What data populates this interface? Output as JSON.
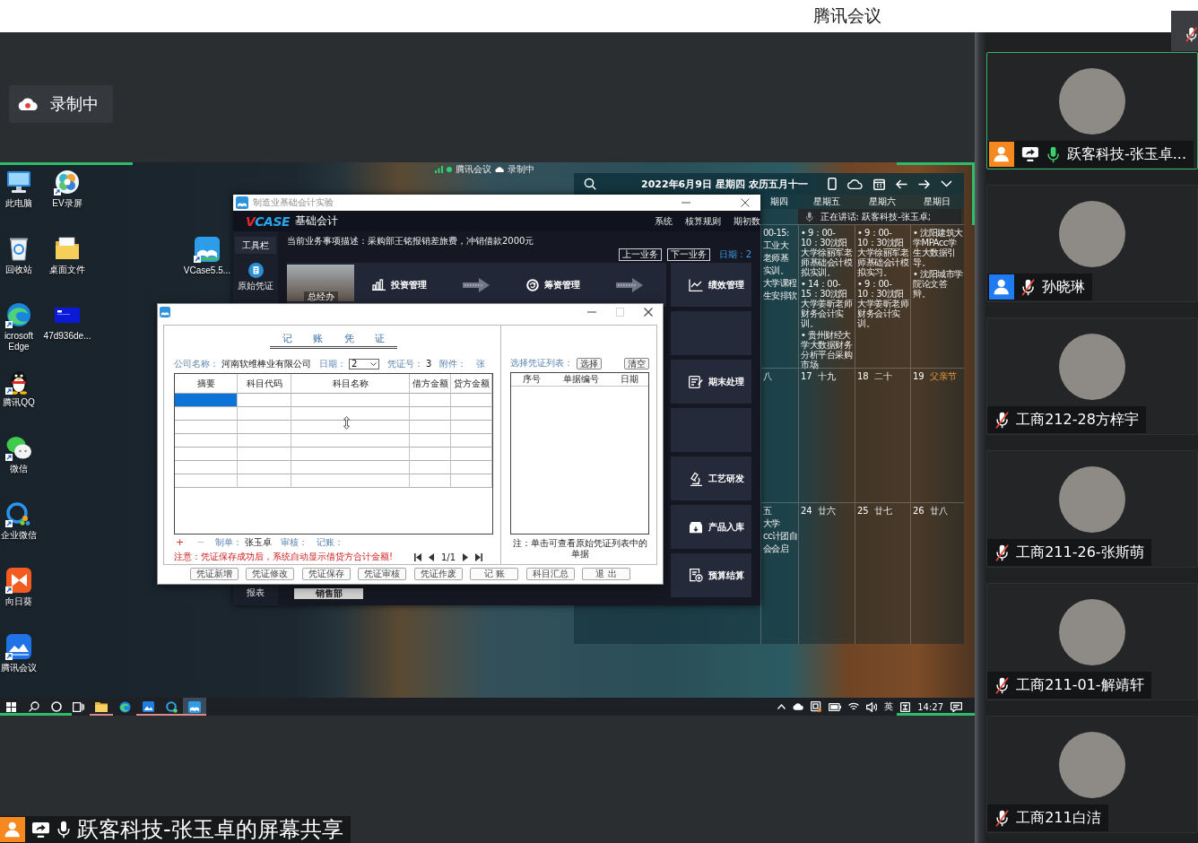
{
  "top_bar": {
    "title": "腾讯会议"
  },
  "recording": {
    "label": "录制中"
  },
  "shared_screen": {
    "icon_columns": [
      [
        {
          "label": "此电脑",
          "kind": "computer",
          "shortcut": false
        },
        {
          "label": "回收站",
          "kind": "recycle",
          "shortcut": false
        },
        {
          "label": "icrosoft Edge",
          "kind": "edge",
          "shortcut": true
        },
        {
          "label": "腾讯QQ",
          "kind": "qq",
          "shortcut": true
        },
        {
          "label": "微信",
          "kind": "wechat",
          "shortcut": true
        },
        {
          "label": "企业微信",
          "kind": "wecom",
          "shortcut": true
        },
        {
          "label": "向日葵",
          "kind": "sunlogin",
          "shortcut": true
        },
        {
          "label": "腾讯会议",
          "kind": "meeting",
          "shortcut": true
        }
      ],
      [
        {
          "label": "EV录屏",
          "kind": "ev",
          "shortcut": true
        },
        {
          "label": "桌面文件",
          "kind": "folder",
          "shortcut": false
        },
        {
          "label": "47d936de...",
          "kind": "image",
          "shortcut": false
        }
      ]
    ],
    "app_shortcut": {
      "label": "VCase5.5...",
      "kind": "vcase",
      "shortcut": true
    },
    "meeting_bar": {
      "app": "腾讯会议",
      "status": "录制中"
    },
    "calendar": {
      "date_line": "2022年6月9日 星期四 农历五月十一",
      "weekdays": [
        "期四",
        "星期五",
        "星期六",
        "星期日"
      ],
      "weeks": [
        {
          "days": [
            {
              "fragments": [
                "00-15:",
                "工业大",
                "老师基",
                "实训。",
                "大学课程",
                "生安排软"
              ]
            },
            {
              "events": [
                "• 9：00-10：30沈阳大学徐丽军老师基础会计模拟实训。",
                "• 14：00-15：30沈阳大学姜昕老师财务会计实训。",
                "• 贵州财经大学大数据财务分析平台采购市场"
              ]
            },
            {
              "events": [
                "• 9：00-10：30沈阳大学徐丽军老师基础会计模拟实习。",
                "• 9：00-10：30沈阳大学姜昕老师财务会计实训。"
              ]
            },
            {
              "events": [
                "• 沈阳建筑大学MPAcc学生大数据引导。",
                "• 沈阳城市学院论文答辩。"
              ]
            }
          ]
        },
        {
          "days": [
            {
              "fragments": [
                "八"
              ]
            },
            {
              "date": "17",
              "lunar": "十九",
              "festival": false
            },
            {
              "date": "18",
              "lunar": "二十",
              "festival": false
            },
            {
              "date": "19",
              "lunar": "父亲节",
              "festival": true
            }
          ]
        },
        {
          "days": [
            {
              "fragments": [
                "五",
                "大学",
                "cc计团自",
                "会会启"
              ]
            },
            {
              "date": "24",
              "lunar": "廿六",
              "festival": false
            },
            {
              "date": "25",
              "lunar": "廿七",
              "festival": false
            },
            {
              "date": "26",
              "lunar": "廿八",
              "festival": false
            }
          ]
        }
      ]
    },
    "speaking": {
      "label": "正在讲话: 跃客科技-张玉卓;"
    },
    "app_window": {
      "title": "制造业基础会计实验",
      "logo": [
        "V",
        "CASE"
      ],
      "product": "基础会计",
      "menu": [
        "系统",
        "核算规则",
        "期初数"
      ],
      "toolbar": {
        "label": "工具栏",
        "tools": [
          {
            "label": "原始凭证"
          }
        ],
        "bottom": "报表"
      },
      "task": "当前业务事项描述：采购部王铭报销差旅费，冲销借款2000元",
      "nav": [
        "上一业务",
        "下一业务"
      ],
      "date": "日期：2",
      "department": "总经办",
      "flow": [
        {
          "label": "投资管理",
          "kind": "bars"
        },
        {
          "label": "筹资管理",
          "kind": "cycle"
        }
      ],
      "modules": [
        {
          "kind": "trend",
          "label": "绩效管理"
        },
        {
          "kind": "blank"
        },
        {
          "kind": "doc",
          "label": "期末处理"
        },
        {
          "kind": "blank"
        },
        {
          "kind": "lab",
          "label": "工艺研发"
        },
        {
          "kind": "box",
          "label": "产品入库"
        },
        {
          "kind": "budget",
          "label": "预算结算"
        }
      ],
      "tab": "销售部"
    },
    "voucher": {
      "title": "记 账 凭 证",
      "fields": [
        {
          "label": "公司名称：",
          "value": "河南软维棒业有限公司",
          "kind": "text"
        },
        {
          "label": "日期：",
          "value": "2",
          "kind": "select"
        },
        {
          "label": "凭证号：",
          "value": "3",
          "kind": "text"
        },
        {
          "label": "附件：",
          "value": "张",
          "kind": "unit"
        }
      ],
      "columns": [
        "摘要",
        "科目代码",
        "科目名称",
        "借方金额",
        "贷方金额"
      ],
      "rows": [
        {
          "selected": true
        },
        {
          "selected": false
        },
        {
          "selected": false
        },
        {
          "selected": false
        },
        {
          "selected": false
        },
        {
          "selected": false
        },
        {
          "selected": false
        }
      ],
      "row_buttons": [
        {
          "label": "+",
          "disabled": false
        },
        {
          "label": "−",
          "disabled": true
        }
      ],
      "signoffs": [
        {
          "label": "制单：",
          "value": "张玉卓"
        },
        {
          "label": "审核："
        },
        {
          "label": "记账："
        }
      ],
      "note": "注意：凭证保存成功后，系统自动显示借贷方合计金额!",
      "pager": "1/1",
      "list": {
        "label": "选择凭证列表：",
        "buttons": [
          "选择",
          "清空"
        ],
        "columns": [
          "序号",
          "单据编号",
          "日期"
        ],
        "note": "注：单击可查看原始凭证列表中的单据"
      },
      "actions": [
        "凭证新增",
        "凭证修改",
        "凭证保存",
        "凭证审核",
        "凭证作废",
        "记 账",
        "科目汇总",
        "退 出"
      ]
    },
    "taskbar": {
      "apps": [
        {
          "kind": "explorer",
          "running": true,
          "active": false
        },
        {
          "kind": "edge",
          "running": false,
          "active": false
        },
        {
          "kind": "photos",
          "running": true,
          "active": false
        },
        {
          "kind": "ring",
          "running": true,
          "active": false
        },
        {
          "kind": "vcase",
          "running": true,
          "active": true
        }
      ],
      "language": "英",
      "time": "14:27"
    }
  },
  "sharer": {
    "label": "跃客科技-张玉卓的屏幕共享",
    "color": "#f5891f",
    "sharing": true,
    "muted": false
  },
  "participants": [
    {
      "name": "跃客科技-张玉卓...",
      "color": "#f5891f",
      "sharing": true,
      "muted": false,
      "speaking": true
    },
    {
      "name": "孙晓琳",
      "color": "#1e7bf2",
      "sharing": false,
      "muted": true,
      "speaking": false
    },
    {
      "name": "工商212-28方梓宇",
      "sharing": false,
      "muted": true,
      "speaking": false
    },
    {
      "name": "工商211-26-张斯萌",
      "sharing": false,
      "muted": true,
      "speaking": false
    },
    {
      "name": "工商211-01-解靖轩",
      "sharing": false,
      "muted": true,
      "speaking": false
    },
    {
      "name": "工商211白洁",
      "sharing": false,
      "muted": true,
      "speaking": false
    }
  ]
}
